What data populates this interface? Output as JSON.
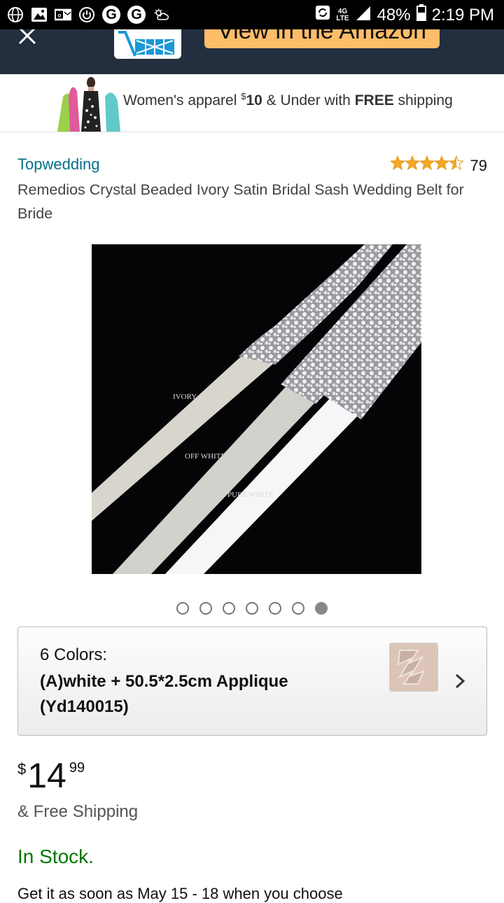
{
  "status_bar": {
    "battery": "48%",
    "time": "2:19 PM",
    "network": "4G LTE"
  },
  "header": {
    "app_button_label": "View in the Amazon app"
  },
  "banner": {
    "text_prefix": "Women's apparel ",
    "price_sym": "$",
    "price": "10",
    "text_mid": " & Under with ",
    "free": "FREE",
    "text_suffix": " shipping"
  },
  "product": {
    "brand": "Topwedding",
    "rating_count": "79",
    "rating_stars": 4.5,
    "title": "Remedios Crystal Beaded Ivory Satin Bridal Sash Wedding Belt for Bride",
    "image_labels": [
      "IVORY",
      "OFF WHITE",
      "PURE WHITE"
    ],
    "image_count": 7,
    "image_active_index": 6
  },
  "variant": {
    "label": "6 Colors:",
    "value": "(A)white + 50.5*2.5cm Applique (Yd140015)"
  },
  "price": {
    "symbol": "$",
    "whole": "14",
    "fraction": "99"
  },
  "shipping": "& Free Shipping",
  "stock": "In Stock.",
  "delivery": "Get it as soon as May 15 - 18 when you choose",
  "colors": {
    "header_bg": "#232f3e",
    "accent_button": "#febd69",
    "link": "#007185",
    "in_stock": "#007600",
    "star": "#f5a623"
  }
}
